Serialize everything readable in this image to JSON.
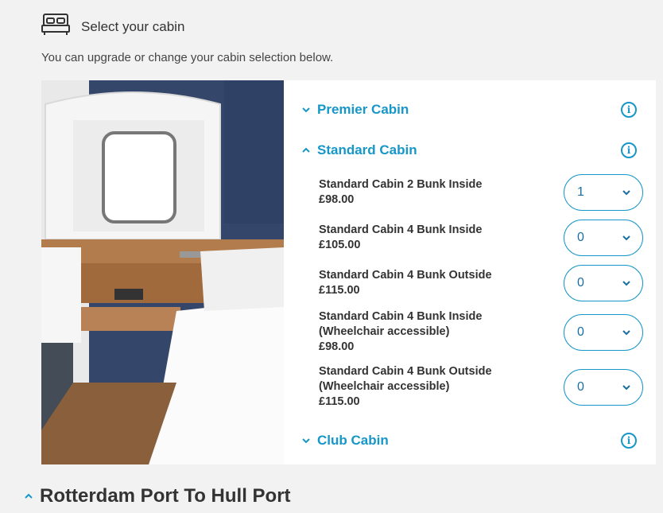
{
  "header": {
    "icon": "bed-icon",
    "title": "Select your cabin"
  },
  "subtitle": "You can upgrade or change your cabin selection below.",
  "image": {
    "description_icon": "cabin-photo"
  },
  "categories": [
    {
      "label": "Premier Cabin",
      "expanded": false
    },
    {
      "label": "Standard Cabin",
      "expanded": true
    },
    {
      "label": "Club Cabin",
      "expanded": false
    }
  ],
  "options": [
    {
      "name": "Standard Cabin 2 Bunk Inside",
      "price": "£98.00",
      "qty": "1"
    },
    {
      "name": "Standard Cabin 4 Bunk Inside",
      "price": "£105.00",
      "qty": "0"
    },
    {
      "name": "Standard Cabin 4 Bunk Outside",
      "price": "£115.00",
      "qty": "0"
    },
    {
      "name": "Standard Cabin 4 Bunk Inside (Wheelchair accessible)",
      "name_line1": "Standard Cabin 4 Bunk Inside",
      "name_line2": "(Wheelchair accessible)",
      "price": "£98.00",
      "qty": "0"
    },
    {
      "name": "Standard Cabin 4 Bunk Outside (Wheelchair accessible)",
      "name_line1": "Standard Cabin 4 Bunk Outside",
      "name_line2": "(Wheelchair accessible)",
      "price": "£115.00",
      "qty": "0"
    }
  ],
  "route": {
    "title": "Rotterdam Port To Hull Port",
    "expanded": true
  },
  "colors": {
    "accent": "#1796c8",
    "background": "#f2f2f2",
    "text": "#333333"
  }
}
